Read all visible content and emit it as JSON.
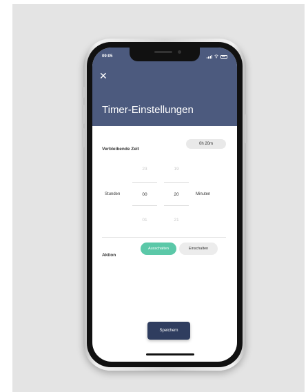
{
  "status_bar": {
    "time": "09:05"
  },
  "header": {
    "close_icon": "close-icon",
    "title": "Timer-Einstellungen"
  },
  "remaining": {
    "label": "Verbleibende Zeit",
    "value": "0h 20m"
  },
  "picker": {
    "hours_label": "Stunden",
    "minutes_label": "Minuten",
    "hours": {
      "prev": "23",
      "selected": "00",
      "next": "01"
    },
    "minutes": {
      "prev": "19",
      "selected": "20",
      "next": "21"
    }
  },
  "action": {
    "label": "Aktion",
    "options": [
      "Ausschalten",
      "Einschalten"
    ],
    "selected": "Ausschalten"
  },
  "save_button": {
    "label": "Speichern"
  },
  "colors": {
    "header": "#4c5a7e",
    "accent": "#5bc8a8",
    "button": "#2f3d5f"
  }
}
